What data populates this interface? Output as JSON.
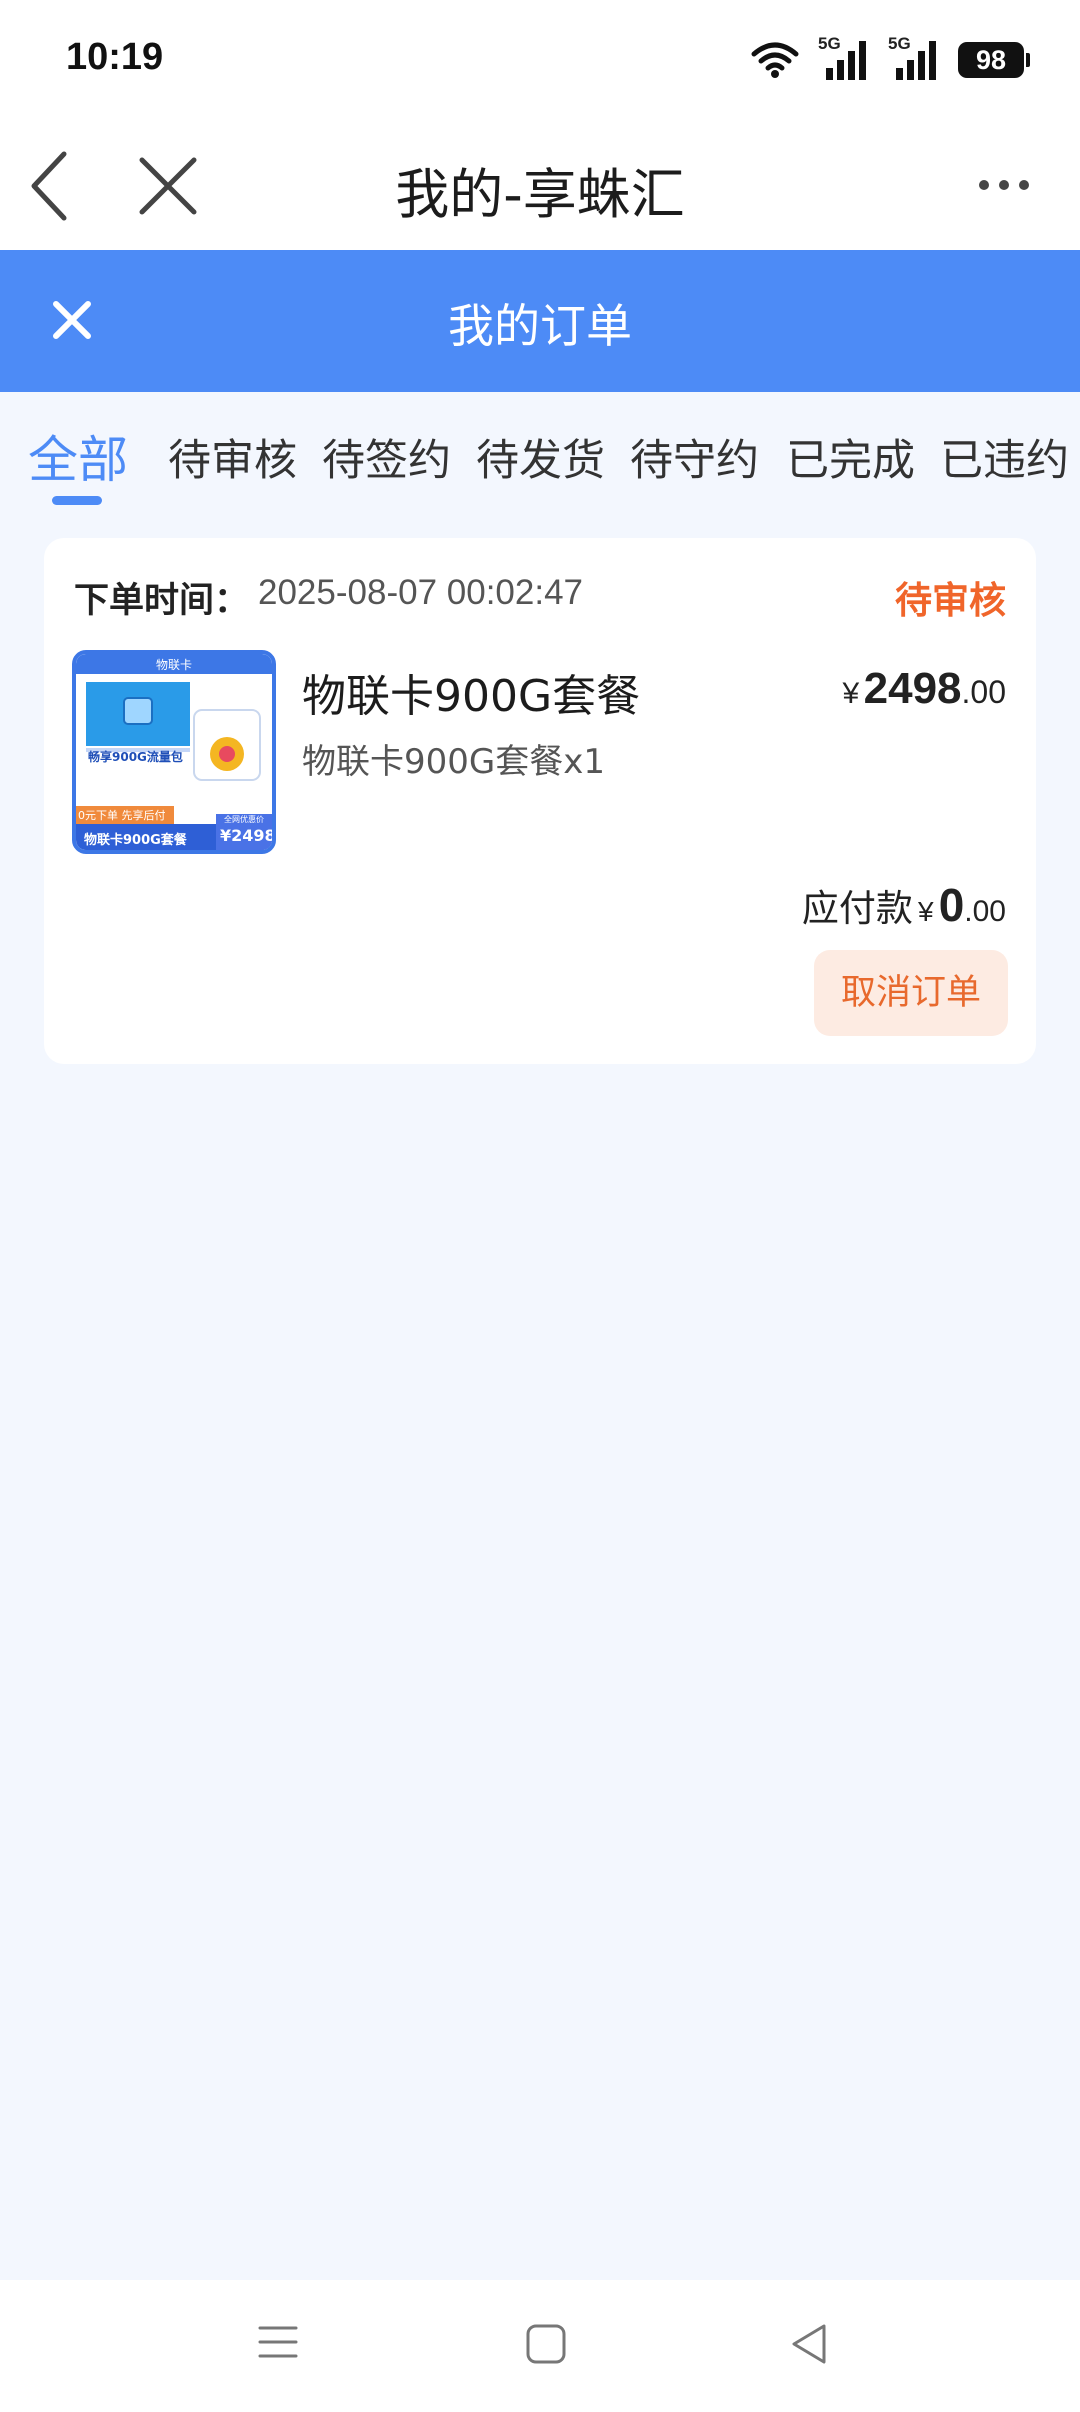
{
  "status_bar": {
    "time": "10:19",
    "signal1_label": "5G",
    "signal2_label": "5G",
    "battery": "98"
  },
  "top_nav": {
    "title": "我的-享蛛汇",
    "icons": [
      "back-icon",
      "close-icon",
      "more-icon"
    ]
  },
  "header": {
    "title": "我的订单",
    "close_icon": "close-icon",
    "color": "#4d8bf6"
  },
  "tabs": [
    {
      "label": "全部",
      "active": true
    },
    {
      "label": "待审核",
      "active": false
    },
    {
      "label": "待签约",
      "active": false
    },
    {
      "label": "待发货",
      "active": false
    },
    {
      "label": "待守约",
      "active": false
    },
    {
      "label": "已完成",
      "active": false
    },
    {
      "label": "已违约",
      "active": false
    }
  ],
  "order": {
    "time_label": "下单时间：",
    "time_value": "2025-08-07 00:02:47",
    "status": "待审核",
    "status_color": "#f0652a",
    "product": {
      "name": "物联卡900G套餐",
      "subtitle": "物联卡900G套餐x1",
      "price_currency": "¥",
      "price_integer": "2498",
      "price_decimal": ".00",
      "thumbnail": {
        "top_label": "物联卡",
        "headline": "畅享900G流量包",
        "banner": "0元下单 先享后付",
        "bottom_label": "物联卡900G套餐",
        "price_tag": "¥2498",
        "price_caption": "全网优惠价"
      }
    },
    "payable_label": "应付款",
    "payable_currency": "¥",
    "payable_integer": "0",
    "payable_decimal": ".00",
    "cancel_label": "取消订单"
  },
  "bottom_nav": {
    "icons": [
      "menu-icon",
      "home-icon",
      "back-triangle-icon"
    ]
  }
}
